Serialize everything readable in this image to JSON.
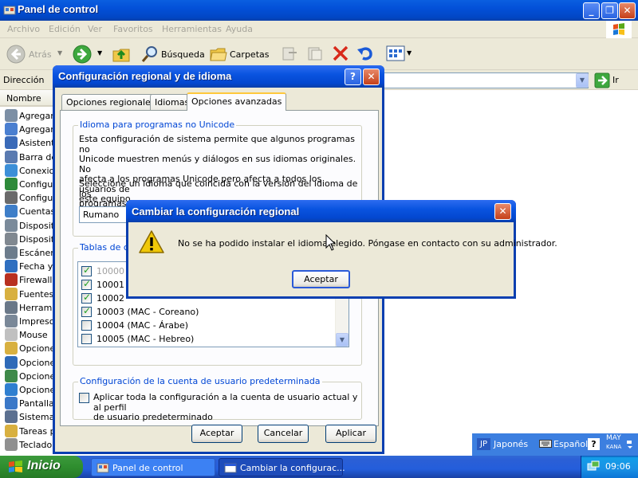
{
  "explorer": {
    "title": "Panel de control",
    "menu": [
      "Archivo",
      "Edición",
      "Ver",
      "Favoritos",
      "Herramientas",
      "Ayuda"
    ],
    "toolbar": {
      "back": "Atrás",
      "search": "Búsqueda",
      "folders": "Carpetas"
    },
    "address_label": "Dirección",
    "go_label": "Ir",
    "column_header": "Nombre",
    "items": [
      {
        "label": "Agregar",
        "color": "#7c8fa5"
      },
      {
        "label": "Agregar",
        "color": "#4a7fd0"
      },
      {
        "label": "Asistente",
        "color": "#3a6ab8"
      },
      {
        "label": "Barra de",
        "color": "#5a7ab0"
      },
      {
        "label": "Conexion",
        "color": "#3c8fd8"
      },
      {
        "label": "Configura",
        "color": "#2e8a3a"
      },
      {
        "label": "Configura",
        "color": "#6a6a6a"
      },
      {
        "label": "Cuentas",
        "color": "#3e7ec8"
      },
      {
        "label": "Dispositiv",
        "color": "#7a8a9a"
      },
      {
        "label": "Dispositiv",
        "color": "#808890"
      },
      {
        "label": "Escáneres",
        "color": "#6c7c8c"
      },
      {
        "label": "Fecha y",
        "color": "#2f6fc0"
      },
      {
        "label": "Firewall d",
        "color": "#b83020"
      },
      {
        "label": "Fuentes",
        "color": "#d8b040"
      },
      {
        "label": "Herramie",
        "color": "#6a7888"
      },
      {
        "label": "Impresor",
        "color": "#7a8898"
      },
      {
        "label": "Mouse",
        "color": "#c0c0c0"
      },
      {
        "label": "Opciones",
        "color": "#d8b040"
      },
      {
        "label": "Opciones",
        "color": "#2e6ab8"
      },
      {
        "label": "Opciones",
        "color": "#3f8a4a"
      },
      {
        "label": "Opciones",
        "color": "#2f7fd0"
      },
      {
        "label": "Pantalla",
        "color": "#3a78c8"
      },
      {
        "label": "Sistema",
        "color": "#5c7090"
      },
      {
        "label": "Tareas p",
        "color": "#d8b040"
      },
      {
        "label": "Teclado",
        "color": "#909090"
      }
    ]
  },
  "regional": {
    "title": "Configuración regional y de idioma",
    "tabs": [
      "Opciones regionales",
      "Idiomas",
      "Opciones avanzadas"
    ],
    "active_tab": "Opciones avanzadas",
    "unicode_group": {
      "legend": "Idioma para programas no Unicode",
      "p1_lines": [
        "Esta configuración de sistema permite que algunos programas no",
        "Unicode muestren menús y diálogos en sus idiomas originales. No",
        "afecta a los programas Unicode pero afecta a todos los usuarios de",
        "este equipo."
      ],
      "p2_lines": [
        "Seleccione un idioma que coincida con la versión del idioma de los",
        "programas no Unicode que desea utilizar:"
      ],
      "selected_language": "Rumano"
    },
    "tables_group": {
      "legend": "Tablas de co",
      "rows": [
        {
          "label": "10000",
          "checked": true
        },
        {
          "label": "10001",
          "checked": true
        },
        {
          "label": "10002",
          "checked": true
        },
        {
          "label": "10003 (MAC - Coreano)",
          "checked": true
        },
        {
          "label": "10004 (MAC - Árabe)",
          "checked": false
        },
        {
          "label": "10005 (MAC - Hebreo)",
          "checked": false
        }
      ]
    },
    "account_group": {
      "legend": "Configuración de la cuenta de usuario predeterminada",
      "checkbox_lines": [
        "Aplicar toda la configuración a la cuenta de usuario actual y al perfil",
        "de usuario predeterminado"
      ]
    },
    "buttons": {
      "ok": "Aceptar",
      "cancel": "Cancelar",
      "apply": "Aplicar"
    }
  },
  "error_dialog": {
    "title": "Cambiar la configuración regional",
    "message": "No se ha podido instalar el idioma elegido. Póngase en contacto con su administrador.",
    "ok": "Aceptar"
  },
  "langbar": {
    "code": "JP",
    "lang": "Japonés",
    "kb": "Español",
    "caps1": "MAY",
    "caps2": "KANA"
  },
  "taskbar": {
    "start": "Inicio",
    "tasks": [
      "Panel de control",
      "Cambiar la configurac..."
    ],
    "clock": "09:06"
  },
  "colors": {
    "title_blue": "#0350d8",
    "group_legend": "#0046d5",
    "start_green": "#2f8e2f",
    "error_icon": "#f0c808"
  }
}
